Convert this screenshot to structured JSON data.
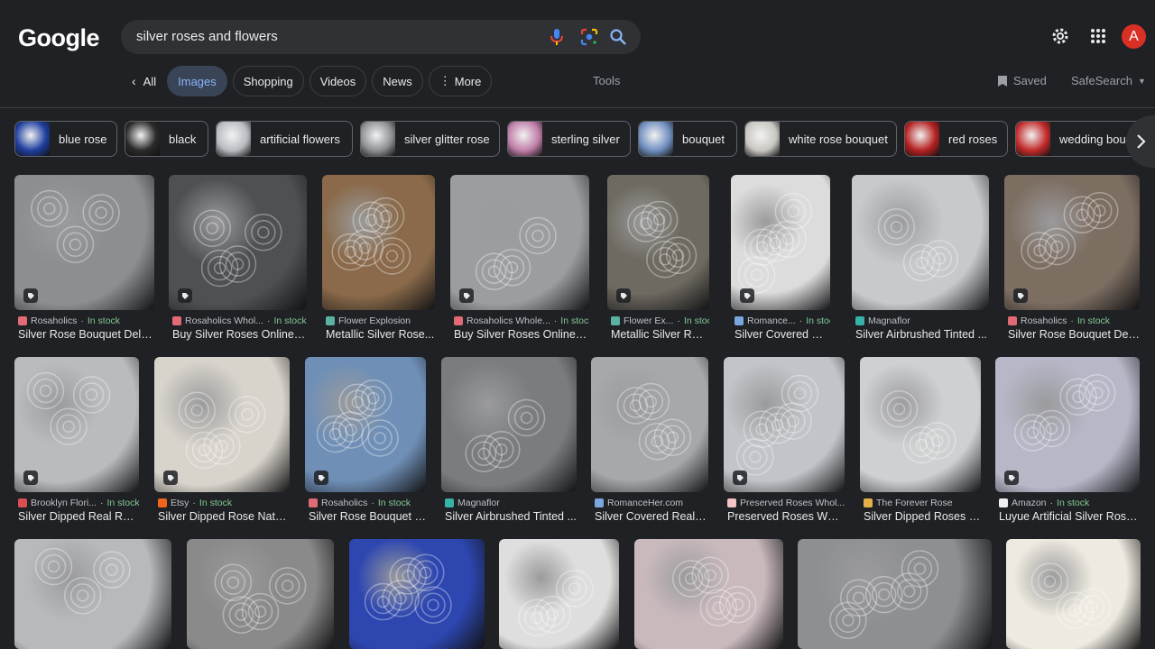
{
  "header": {
    "logo": "Google",
    "search_query": "silver roses and flowers",
    "avatar_letter": "A"
  },
  "tabs": [
    {
      "label": "All"
    },
    {
      "label": "Images"
    },
    {
      "label": "Shopping"
    },
    {
      "label": "Videos"
    },
    {
      "label": "News"
    },
    {
      "label": "More"
    }
  ],
  "toolbar": {
    "tools_label": "Tools",
    "saved_label": "Saved",
    "safesearch_label": "SafeSearch"
  },
  "chips": [
    {
      "label": "blue rose",
      "color": "#1f3f9e"
    },
    {
      "label": "black",
      "color": "#2a2a2a"
    },
    {
      "label": "artificial flowers",
      "color": "#b8bcc0"
    },
    {
      "label": "silver glitter rose",
      "color": "#8e9094"
    },
    {
      "label": "sterling silver",
      "color": "#c07fa9"
    },
    {
      "label": "bouquet",
      "color": "#6f8fbf"
    },
    {
      "label": "white rose bouquet",
      "color": "#c9c7c2"
    },
    {
      "label": "red roses",
      "color": "#b52121"
    },
    {
      "label": "wedding bouquet",
      "color": "#c22b2b"
    }
  ],
  "results_row1": [
    {
      "source": "Rosaholics",
      "stock": "In stock",
      "title": "Silver Rose Bouquet Deliv...",
      "color": "#8c8f92",
      "fav": "#e06b75"
    },
    {
      "source": "Rosaholics Whol...",
      "stock": "In stock",
      "title": "Buy Silver Roses Online –...",
      "color": "#4e5053",
      "fav": "#e06b75"
    },
    {
      "source": "Flower Explosion",
      "stock": "",
      "title": "Metallic Silver Rose...",
      "color": "#8a6a4a",
      "fav": "#5bb2a0"
    },
    {
      "source": "Rosaholics Whole...",
      "stock": "In stock",
      "title": "Buy Silver Roses Online – ...",
      "color": "#9b9ea1",
      "fav": "#e06b75"
    },
    {
      "source": "Flower Ex...",
      "stock": "In stock",
      "title": "Metallic Silver Rose...",
      "color": "#6e6a60",
      "fav": "#5bb2a0"
    },
    {
      "source": "Romance...",
      "stock": "In stock",
      "title": "Silver Covered Real ...",
      "color": "#dcdcdc",
      "fav": "#7aa7e0"
    },
    {
      "source": "Magnaflor",
      "stock": "",
      "title": "Silver Airbrushed Tinted ...",
      "color": "#c7c9cb",
      "fav": "#35b3a6"
    },
    {
      "source": "Rosaholics",
      "stock": "In stock",
      "title": "Silver Rose Bouquet Deliv...",
      "color": "#7d6e62",
      "fav": "#e06b75"
    }
  ],
  "results_row2": [
    {
      "source": "Brooklyn Flori...",
      "stock": "In stock",
      "title": "Silver Dipped Real Ros...",
      "color": "#b9bbbd",
      "fav": "#d94f4f"
    },
    {
      "source": "Etsy",
      "stock": "In stock",
      "title": "Silver Dipped Rose Natur...",
      "color": "#d8d4cc",
      "fav": "#f1641e"
    },
    {
      "source": "Rosaholics",
      "stock": "In stock",
      "title": "Silver Rose Bouquet | ...",
      "color": "#6f8fb6",
      "fav": "#e06b75"
    },
    {
      "source": "Magnaflor",
      "stock": "",
      "title": "Silver Airbrushed Tinted ...",
      "color": "#7a7c80",
      "fav": "#35b3a6"
    },
    {
      "source": "RomanceHer.com",
      "stock": "",
      "title": "Silver Covered Real R...",
      "color": "#a6a8aa",
      "fav": "#7aa7e0"
    },
    {
      "source": "Preserved Roses Whol...",
      "stock": "",
      "title": "Preserved Roses Whol...",
      "color": "#c1c4c8",
      "fav": "#f2c4c4"
    },
    {
      "source": "The Forever Rose",
      "stock": "",
      "title": "Silver Dipped Roses - ...",
      "color": "#cfd0d1",
      "fav": "#e4b04a"
    },
    {
      "source": "Amazon",
      "stock": "In stock",
      "title": "Luyue Artificial Silver Rose...",
      "color": "#b6b8c8",
      "fav": "#f0f0f0"
    }
  ],
  "results_row3": [
    {
      "color": "#b7b9bd"
    },
    {
      "color": "#8a8a8a"
    },
    {
      "color": "#2d46b0"
    },
    {
      "color": "#dedede"
    },
    {
      "color": "#c9b9bd"
    },
    {
      "color": "#8e8f92"
    },
    {
      "color": "#eeeae0"
    }
  ]
}
